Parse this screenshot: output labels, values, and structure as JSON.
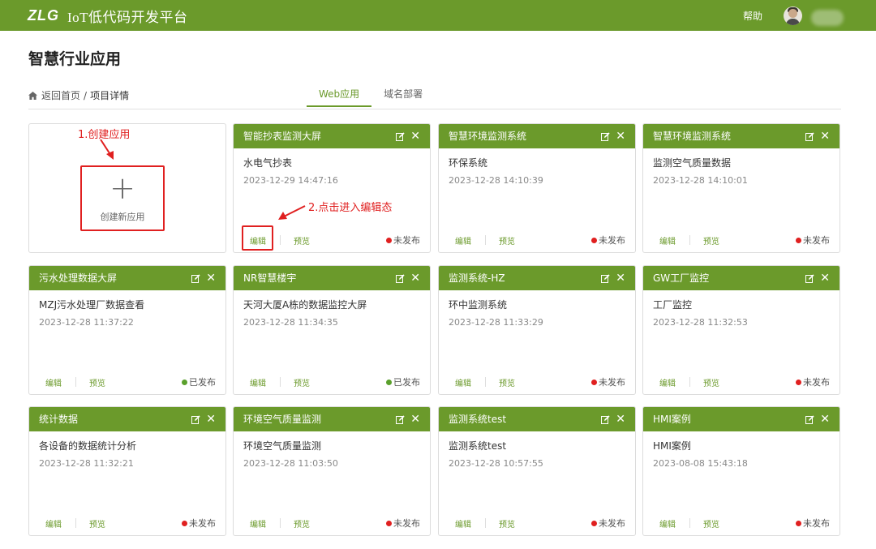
{
  "header": {
    "logo": "ZLG",
    "app_title": "IoT低代码开发平台",
    "help": "帮助"
  },
  "page": {
    "title": "智慧行业应用"
  },
  "breadcrumb": {
    "back": "返回首页",
    "separator": "/",
    "current": "项目详情"
  },
  "tabs": [
    {
      "label": "Web应用",
      "active": true
    },
    {
      "label": "域名部署",
      "active": false
    }
  ],
  "create": {
    "label": "创建新应用",
    "plus": "+"
  },
  "annotations": {
    "step1": "1.创建应用",
    "step2": "2.点击进入编辑态"
  },
  "colors": {
    "accent": "#6b9a2b",
    "published": "#5aa02c",
    "unpublished": "#e02020",
    "annotation": "#e02020"
  },
  "card_actions": {
    "edit": "编辑",
    "preview": "预览"
  },
  "status_labels": {
    "published": "已发布",
    "unpublished": "未发布"
  },
  "cards": [
    {
      "title": "智能抄表监测大屏",
      "name": "水电气抄表",
      "date": "2023-12-29 14:47:16",
      "status": "未发布",
      "published": false
    },
    {
      "title": "智慧环境监测系统",
      "name": "环保系统",
      "date": "2023-12-28 14:10:39",
      "status": "未发布",
      "published": false
    },
    {
      "title": "智慧环境监测系统",
      "name": "监测空气质量数据",
      "date": "2023-12-28 14:10:01",
      "status": "未发布",
      "published": false
    },
    {
      "title": "污水处理数据大屏",
      "name": "MZJ污水处理厂数据查看",
      "date": "2023-12-28 11:37:22",
      "status": "已发布",
      "published": true
    },
    {
      "title": "NR智慧楼宇",
      "name": "天河大厦A栋的数据监控大屏",
      "date": "2023-12-28 11:34:35",
      "status": "已发布",
      "published": true
    },
    {
      "title": "监测系统-HZ",
      "name": "环中监测系统",
      "date": "2023-12-28 11:33:29",
      "status": "未发布",
      "published": false
    },
    {
      "title": "GW工厂监控",
      "name": "工厂监控",
      "date": "2023-12-28 11:32:53",
      "status": "未发布",
      "published": false
    },
    {
      "title": "统计数据",
      "name": "各设备的数据统计分析",
      "date": "2023-12-28 11:32:21",
      "status": "未发布",
      "published": false
    },
    {
      "title": "环境空气质量监测",
      "name": "环境空气质量监测",
      "date": "2023-12-28 11:03:50",
      "status": "未发布",
      "published": false
    },
    {
      "title": "监测系统test",
      "name": "监测系统test",
      "date": "2023-12-28 10:57:55",
      "status": "未发布",
      "published": false
    },
    {
      "title": "HMI案例",
      "name": "HMI案例",
      "date": "2023-08-08 15:43:18",
      "status": "未发布",
      "published": false
    }
  ]
}
